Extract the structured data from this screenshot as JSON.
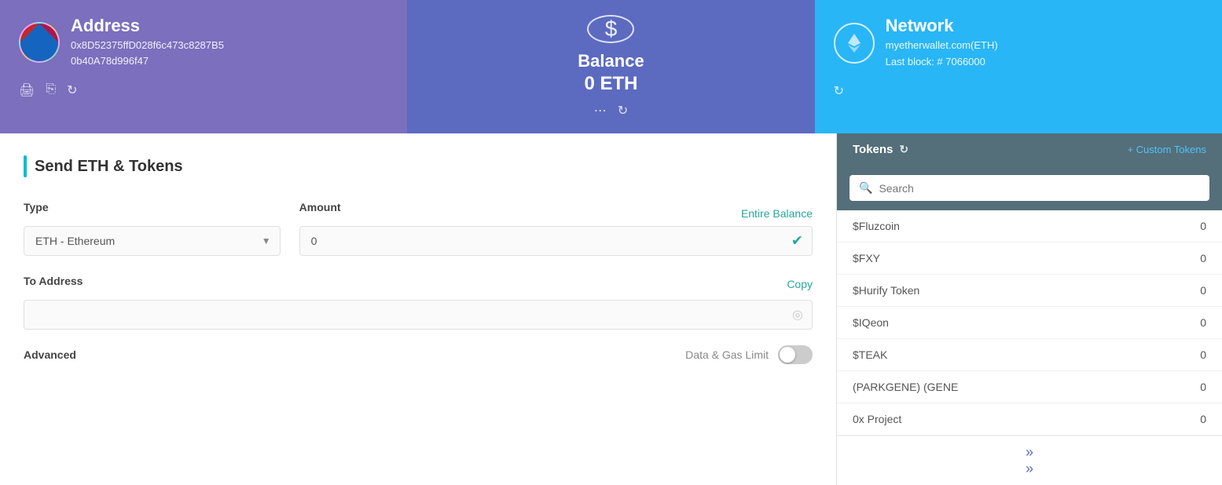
{
  "header": {
    "address_title": "Address",
    "address_line1": "0x8D52375ffD028f6c473c8287B5",
    "address_line2": "0b40A78d996f47",
    "balance_title": "Balance",
    "balance_amount": "0",
    "balance_currency": "ETH",
    "network_title": "Network",
    "network_name": "myetherwallet.com(ETH)",
    "network_block": "Last block: # 7066000"
  },
  "send_section": {
    "title": "Send ETH & Tokens",
    "type_label": "Type",
    "type_value": "ETH - Ethereum",
    "amount_label": "Amount",
    "amount_value": "0",
    "entire_balance": "Entire Balance",
    "to_address_label": "To Address",
    "copy_label": "Copy",
    "advanced_label": "Advanced",
    "gas_limit_label": "Data & Gas Limit"
  },
  "tokens": {
    "title": "Tokens",
    "custom_tokens": "+ Custom Tokens",
    "search_placeholder": "Search",
    "list": [
      {
        "name": "$Fluzcoin",
        "amount": "0"
      },
      {
        "name": "$FXY",
        "amount": "0"
      },
      {
        "name": "$Hurify Token",
        "amount": "0"
      },
      {
        "name": "$IQeon",
        "amount": "0"
      },
      {
        "name": "$TEAK",
        "amount": "0"
      },
      {
        "name": "(PARKGENE) (GENE",
        "amount": "0"
      },
      {
        "name": "0x Project",
        "amount": "0"
      }
    ]
  },
  "icons": {
    "print": "🖨",
    "copy": "📋",
    "refresh": "🔄",
    "more": "···",
    "ethereum_symbol": "◈",
    "shield": "🛡"
  }
}
